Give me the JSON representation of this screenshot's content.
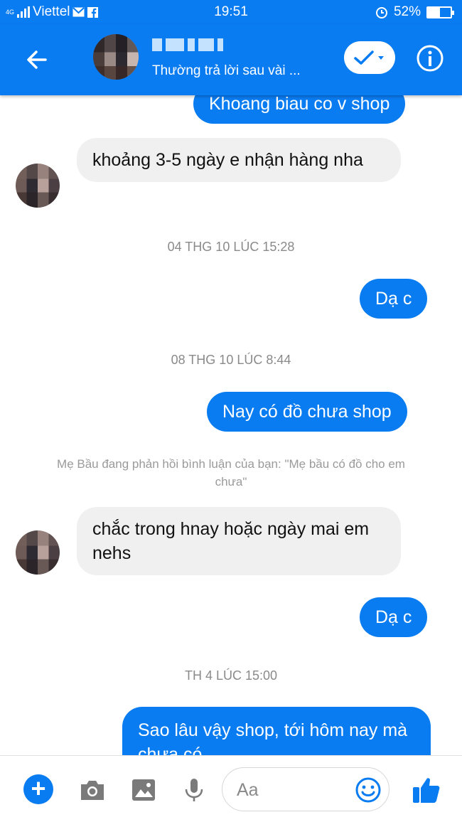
{
  "status_bar": {
    "network": "4G",
    "carrier": "Viettel",
    "time": "19:51",
    "battery": "52%",
    "battery_level": 0.52
  },
  "header": {
    "subtitle": "Thường trả lời sau vài ...",
    "accent_color": "#0a7cf2"
  },
  "messages": {
    "m1_out": "Khoang biau co v shop",
    "m2_in": "khoảng 3-5 ngày e nhận hàng nha",
    "ts1": "04 THG 10 LÚC 15:28",
    "m3_out": "Dạ c",
    "ts2": "08 THG 10 LÚC 8:44",
    "m4_out": "Nay có đồ chưa shop",
    "notice": "Mẹ Bầu đang phản hồi bình luận của bạn: \"Mẹ bầu có đồ cho em chưa\"",
    "m5_in": "chắc trong hnay hoặc ngày mai em nehs",
    "m6_out": "Dạ c",
    "ts3": "TH 4 LÚC 15:00",
    "m7_out": "Sao lâu vậy shop, tới hôm nay mà chưa có"
  },
  "composer": {
    "placeholder": "Aa",
    "icons": [
      "plus-icon",
      "camera-icon",
      "image-icon",
      "microphone-icon",
      "emoji-icon",
      "thumbs-up-icon"
    ]
  }
}
